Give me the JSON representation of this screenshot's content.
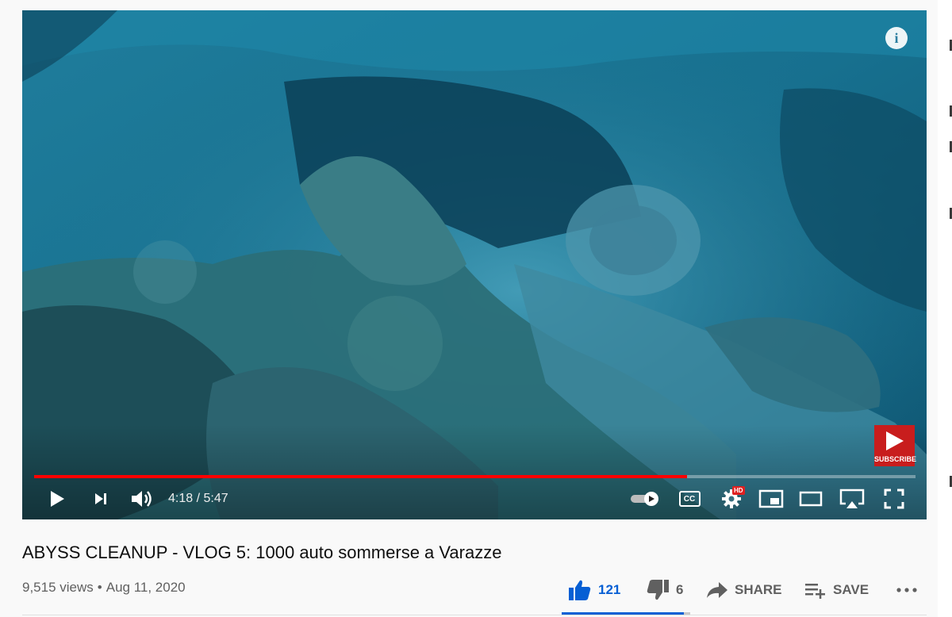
{
  "player": {
    "time": {
      "current": "4:18",
      "separator": " / ",
      "duration": "5:47"
    },
    "progress": {
      "played_fraction": 0.741
    },
    "watermark": {
      "label": "SUBSCRIBE"
    },
    "controls": {
      "play": "play-icon",
      "next": "next-icon",
      "volume": "volume-icon",
      "autoplay": "autoplay-toggle-icon",
      "captions": "CC",
      "settings": "gear-icon",
      "quality_badge": "HD",
      "miniplayer": "miniplayer-icon",
      "theater": "theater-icon",
      "airplay": "airplay-icon",
      "fullscreen": "fullscreen-icon"
    }
  },
  "video": {
    "title": "ABYSS CLEANUP - VLOG 5: 1000 auto sommerse a Varazze",
    "views": "9,515 views",
    "separator": "•",
    "date": "Aug 11, 2020"
  },
  "actions": {
    "likes": "121",
    "dislikes": "6",
    "share_label": "SHARE",
    "save_label": "SAVE",
    "like_fraction": 0.953
  },
  "colors": {
    "accent_red": "#ff0000",
    "like_blue": "#065fd4",
    "meta_gray": "#606060"
  }
}
